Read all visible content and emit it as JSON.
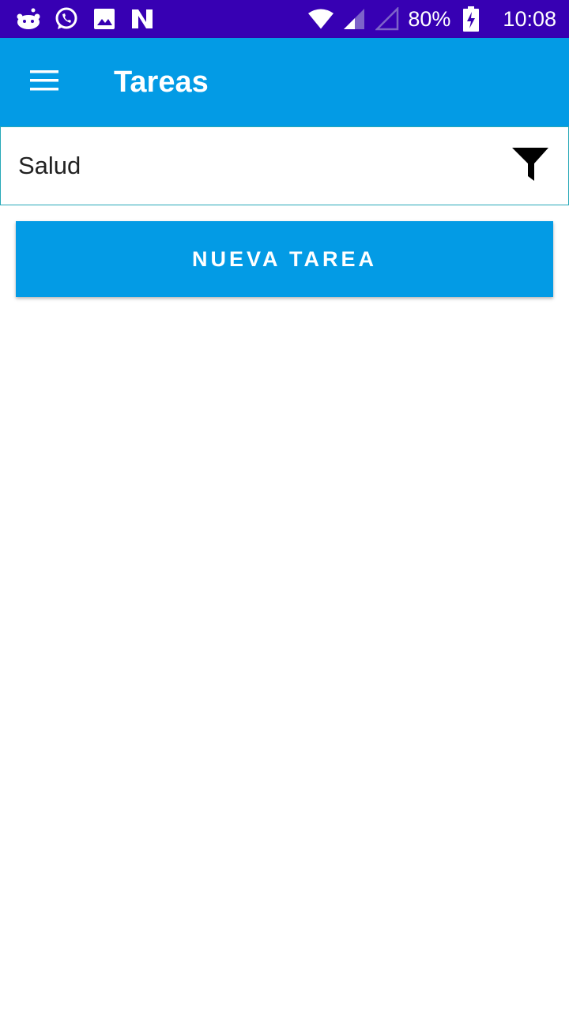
{
  "status_bar": {
    "left_icons": [
      "reddit-icon",
      "whatsapp-icon",
      "gallery-icon",
      "news-icon"
    ],
    "right_icons": [
      "wifi-icon",
      "cell-signal-icon",
      "cell-signal-2-icon",
      "battery-charging-icon"
    ],
    "battery_percent": "80%",
    "time": "10:08"
  },
  "app_bar": {
    "title": "Tareas",
    "menu_icon": "hamburger-menu-icon"
  },
  "filter": {
    "selected_value": "Salud",
    "icon": "filter-funnel-icon"
  },
  "actions": {
    "new_task_label": "NUEVA TAREA"
  },
  "colors": {
    "status_bar": "#3700b3",
    "primary": "#039be5",
    "filter_border": "#26a8b8"
  }
}
